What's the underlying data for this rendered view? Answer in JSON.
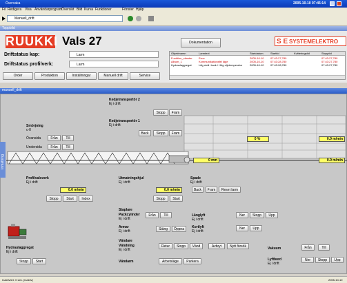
{
  "window": {
    "title": "Övervaka",
    "datetime": "2005-10-10  07:45:14"
  },
  "menu": [
    "Fil",
    "Redigera",
    "Visa",
    "Användarprogram",
    "Översikt",
    "Bild",
    "Kurva",
    "Funktioner",
    "Fönster",
    "Hjälp"
  ],
  "addressbar": {
    "value": "Manuell_drift"
  },
  "header_tab": "Toppbild",
  "logo": "RUUKKI",
  "page_title": "Vals 27",
  "doc_button": "Dokumentation",
  "brand": "SYSTEMELEKTRO",
  "status": {
    "driftstatus_label": "Driftstatus kap:",
    "driftstatus_value": "Larm",
    "profil_label": "Driftstatus profilverk:",
    "profil_value": "Larm"
  },
  "nav_buttons": [
    "Order",
    "Produktion",
    "Inställningar",
    "Manuell drift",
    "Service"
  ],
  "alarms": {
    "columns": [
      "Objektnamn",
      "Larmtext",
      "Startdatum",
      "Starttid",
      "Kvitteringstid",
      "Stopptid"
    ],
    "rows": [
      [
        "Funktion_vänster",
        "Error",
        "2005-10-10",
        "07:43:27,780",
        "",
        "07:43:27,780"
      ],
      [
        "Album_1",
        "Kommunikationsfel läge",
        "2005-10-10",
        "07:43:28,780",
        "",
        "07:43:27,780"
      ],
      [
        "Hydraulaggregat",
        "Låg nivå i tank / Hög oljetemperatur",
        "2005-10-10",
        "07:43:28,780",
        "",
        "07:43:27,780"
      ]
    ]
  },
  "main_tab": "manuell_drift",
  "side_tab": "Inmatning",
  "kt2": {
    "title": "Kedjetransportör 2",
    "status": "Ej i drift",
    "btns": [
      "Stopp",
      "Fram"
    ]
  },
  "kt1": {
    "title": "Kedjetransportör 1",
    "status": "Ej i drift",
    "btns": [
      "Back",
      "Stopp",
      "Fram"
    ]
  },
  "smorjning": {
    "title": "Smörjning",
    "value": "c-0",
    "ovansida": "Övansida",
    "undersida": "Undersida",
    "btns": [
      "Från",
      "Till"
    ]
  },
  "speeds": {
    "pct": "0 %",
    "right1": "0.0 m/min",
    "mid": "0 mm",
    "right2": "0.0 m/min"
  },
  "profilvalsverk": {
    "title": "Profilvalsverk",
    "status": "Ej i drift",
    "speed": "0.0 m/min",
    "btns": [
      "Stopp",
      "Start",
      "Index"
    ]
  },
  "utmatning": {
    "title": "Utmatningshjul",
    "status": "Ej i drift",
    "speed": "0.0 m/min",
    "btns": [
      "Stopp",
      "Start"
    ]
  },
  "spade": {
    "title": "Spade",
    "status": "Ej i drift",
    "btns": [
      "Back",
      "Fram",
      "Reset larm"
    ]
  },
  "staplare": {
    "title": "Staplare",
    "packcylinder": "Packcylinder",
    "pc_status": "Ej i drift",
    "pc_btns": [
      "Från",
      "Till"
    ],
    "armar": "Armar",
    "armar_status": "Ej i drift",
    "armar_btns": [
      "Stäng",
      "Öppna"
    ],
    "langlyft": "Långlyft",
    "ll_status": "Ej i drift",
    "ll_btns": [
      "Ner",
      "Stopp",
      "Upp"
    ],
    "kortlyft": "Kortlyft",
    "kl_status": "Ej i drift",
    "kl_btns": [
      "Ner",
      "Upp"
    ]
  },
  "vandare": {
    "title": "Vändare",
    "vandning": "Vändning",
    "v_status": "Ej i drift",
    "v_btns": [
      "Retur",
      "Stopp",
      "Vänd",
      "Avbryt",
      "Nytt försök"
    ],
    "vandarm": "Vändarm",
    "va_btns": [
      "Arbetsläge",
      "Parkera"
    ]
  },
  "vakuum": {
    "title": "Vakuum",
    "btns": [
      "Från",
      "Till"
    ],
    "lyftbord": "Lyftbord",
    "lb_status": "Ej i drift",
    "lb_btns": [
      "Ner",
      "Stopp",
      "Upp"
    ]
  },
  "hydraul": {
    "title": "Hydraulaggregat",
    "status": "Ej i drift",
    "btns": [
      "Stopp",
      "Start"
    ]
  },
  "statusbar": {
    "left": "Inaktivitet: 0 sek. (inaktiv)",
    "right": "2005-10-10"
  }
}
